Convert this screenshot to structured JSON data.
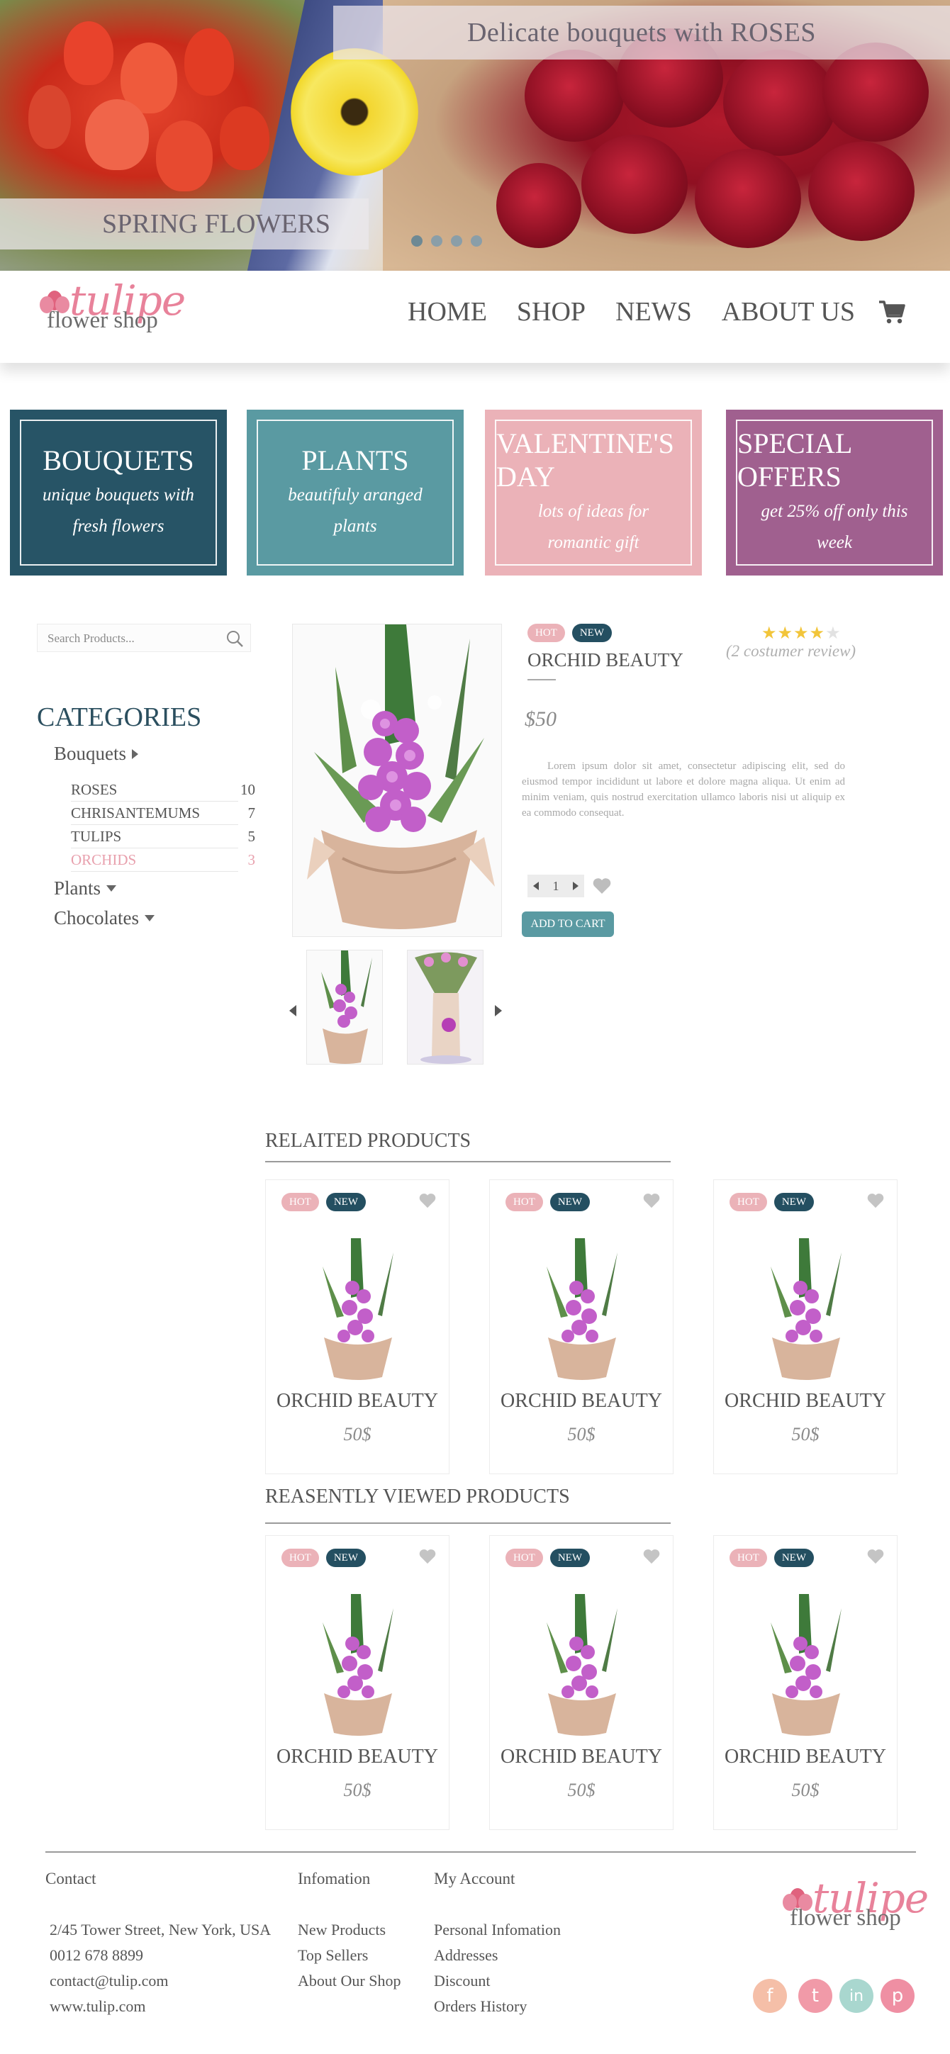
{
  "hero": {
    "headline": "Delicate bouquets with ROSES",
    "caption": "SPRING FLOWERS",
    "slides": 4,
    "active_slide": 1
  },
  "logo": {
    "word1": "tulipe",
    "word2": "flower shop"
  },
  "nav": {
    "items": [
      "HOME",
      "SHOP",
      "NEWS",
      "ABOUT US"
    ],
    "cart_icon": "shopping-cart-icon"
  },
  "tiles": [
    {
      "title": "BOUQUETS",
      "subtitle": "unique bouquets with fresh flowers",
      "color": "#275466"
    },
    {
      "title": "PLANTS",
      "subtitle": "beautifuly aranged plants",
      "color": "#5a9aa2"
    },
    {
      "title": "VALENTINE'S DAY",
      "subtitle": "lots of ideas for romantic gift",
      "color": "#ebb2b8"
    },
    {
      "title": "SPECIAL OFFERS",
      "subtitle": "get 25% off only this week",
      "color": "#a0608f"
    }
  ],
  "sidebar": {
    "search_placeholder": "Search Products...",
    "categories_title": "CATEGORIES",
    "bouquets": "Bouquets",
    "subcategories": [
      {
        "name": "ROSES",
        "count": "10"
      },
      {
        "name": "CHRISANTEMUMS",
        "count": "7"
      },
      {
        "name": "TULIPS",
        "count": "5"
      },
      {
        "name": "ORCHIDS",
        "count": "3"
      }
    ],
    "plants": "Plants",
    "chocolates": "Chocolates"
  },
  "product": {
    "badge_hot": "HOT",
    "badge_new": "NEW",
    "name": "ORCHID BEAUTY",
    "rating": 4,
    "rating_max": 5,
    "review_text": "(2 costumer review)",
    "price": "$50",
    "description": "Lorem ipsum dolor sit amet, consectetur adipiscing elit, sed do eiusmod tempor incididunt ut labore et dolore magna aliqua. Ut enim ad minim veniam, quis nostrud exercitation ullamco laboris nisi ut aliquip ex ea commodo consequat.",
    "quantity": "1",
    "add_to_cart": "ADD TO CART"
  },
  "related": {
    "title": "RELAITED PRODUCTS",
    "items": [
      {
        "hot": "HOT",
        "new": "NEW",
        "name": "ORCHID BEAUTY",
        "price": "50$"
      },
      {
        "hot": "HOT",
        "new": "NEW",
        "name": "ORCHID BEAUTY",
        "price": "50$"
      },
      {
        "hot": "HOT",
        "new": "NEW",
        "name": "ORCHID BEAUTY",
        "price": "50$"
      }
    ]
  },
  "recent": {
    "title": "REASENTLY VIEWED PRODUCTS",
    "items": [
      {
        "hot": "HOT",
        "new": "NEW",
        "name": "ORCHID BEAUTY",
        "price": "50$"
      },
      {
        "hot": "HOT",
        "new": "NEW",
        "name": "ORCHID BEAUTY",
        "price": "50$"
      },
      {
        "hot": "HOT",
        "new": "NEW",
        "name": "ORCHID BEAUTY",
        "price": "50$"
      }
    ]
  },
  "footer": {
    "contact": {
      "title": "Contact",
      "address": "2/45 Tower Street, New York, USA",
      "phone": "0012 678 8899",
      "email": "contact@tulip.com",
      "website": "www.tulip.com"
    },
    "information": {
      "title": "Infomation",
      "links": [
        "New Products",
        "Top Sellers",
        "About Our Shop"
      ]
    },
    "account": {
      "title": "My Account",
      "links": [
        "Personal Infomation",
        "Addresses",
        "Discount",
        "Orders History"
      ]
    },
    "social": [
      {
        "icon": "facebook-icon",
        "glyph": "f",
        "color": "#f5bfa8"
      },
      {
        "icon": "twitter-icon",
        "glyph": "t",
        "color": "#f19aa8"
      },
      {
        "icon": "linkedin-icon",
        "glyph": "in",
        "color": "#a9d7cf"
      },
      {
        "icon": "pinterest-icon",
        "glyph": "p",
        "color": "#ef8fa3"
      }
    ]
  }
}
